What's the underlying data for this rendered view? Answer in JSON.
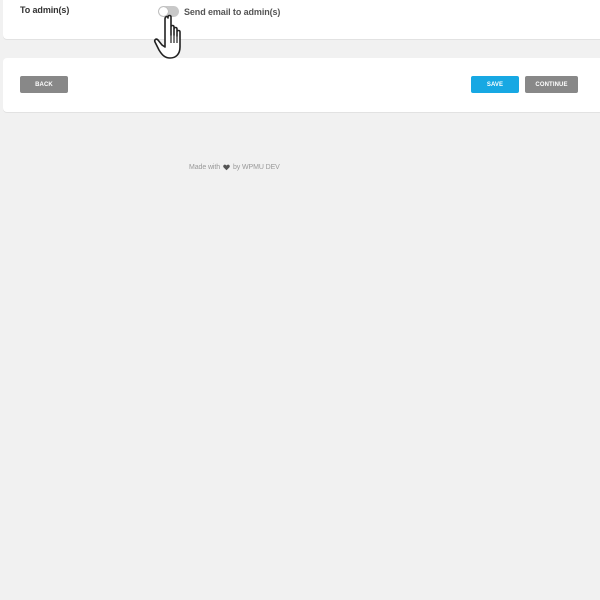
{
  "notifications": {
    "to_admin_label": "To admin(s)",
    "toggle": {
      "label": "Send email to admin(s)",
      "checked": false
    }
  },
  "footer_actions": {
    "back_label": "BACK",
    "save_label": "SAVE",
    "continue_label": "CONTINUE"
  },
  "credits": {
    "made_with": "Made with",
    "by_text": "by WPMU DEV"
  },
  "colors": {
    "primary_blue": "#17a8e3",
    "neutral_button": "#888888",
    "background": "#f1f1f1"
  },
  "icons": {
    "heart": "heart-icon",
    "cursor": "hand-pointer-icon"
  }
}
